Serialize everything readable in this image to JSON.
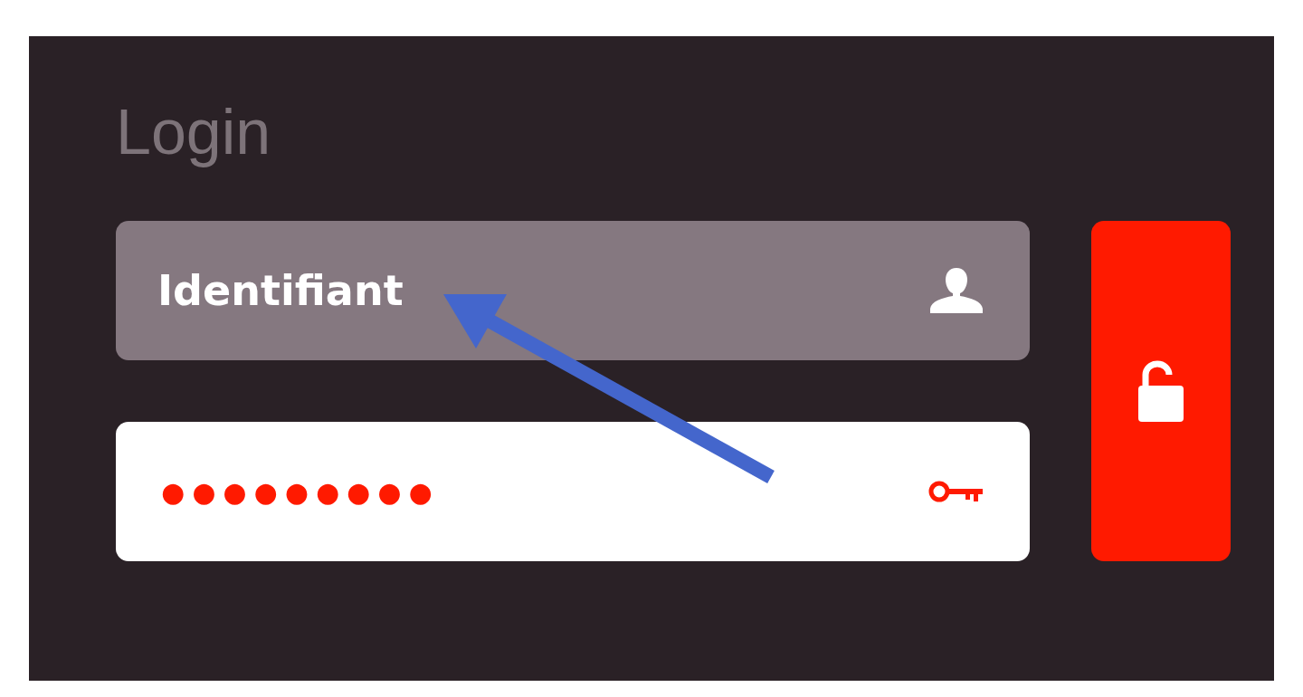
{
  "title": "Login",
  "username": {
    "placeholder": "Identifiant"
  },
  "password": {
    "value": "●●●●●●●●●"
  }
}
